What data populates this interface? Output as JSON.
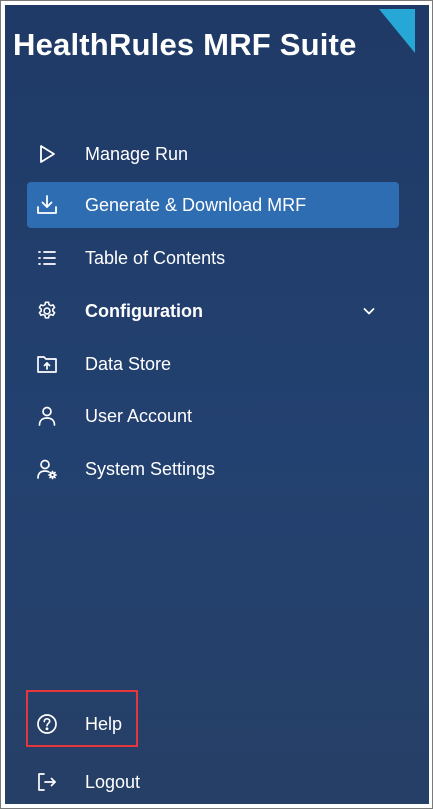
{
  "app": {
    "title": "HealthRules MRF Suite",
    "accent_color": "#27a7d6",
    "highlight_color": "#e5363b"
  },
  "nav": {
    "items": [
      {
        "label": "Manage Run",
        "icon": "play-icon",
        "active": false
      },
      {
        "label": "Generate & Download MRF",
        "icon": "download-icon",
        "active": true
      },
      {
        "label": "Table of Contents",
        "icon": "list-icon",
        "active": false
      },
      {
        "label": "Configuration",
        "icon": "gear-icon",
        "active": false,
        "expandable": true
      },
      {
        "label": "Data Store",
        "icon": "folder-upload-icon",
        "active": false
      },
      {
        "label": "User Account",
        "icon": "user-icon",
        "active": false
      },
      {
        "label": "System Settings",
        "icon": "user-gear-icon",
        "active": false
      }
    ],
    "footer": [
      {
        "label": "Help",
        "icon": "help-circle-icon",
        "highlighted": true
      },
      {
        "label": "Logout",
        "icon": "logout-icon"
      }
    ]
  }
}
